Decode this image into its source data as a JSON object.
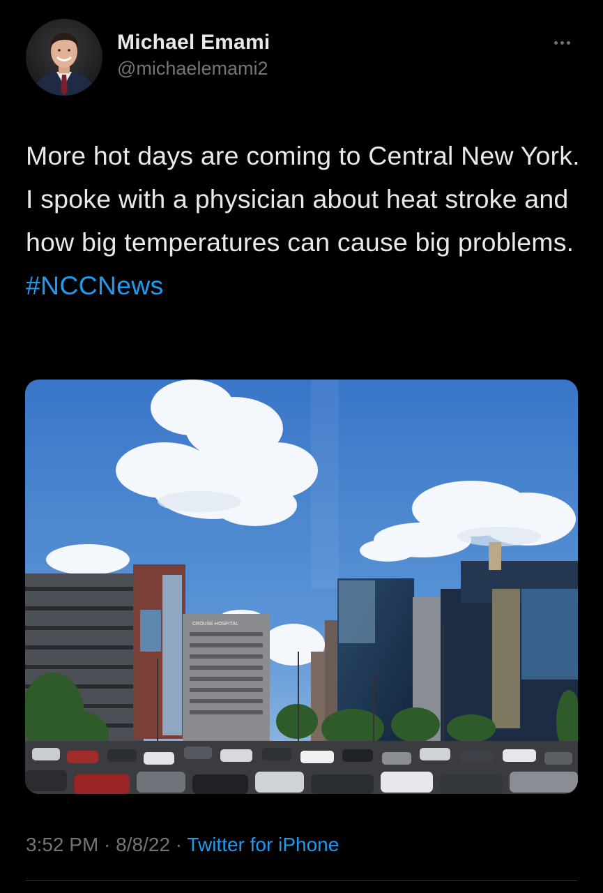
{
  "author": {
    "display_name": "Michael Emami",
    "handle": "@michaelemami2",
    "avatar_icon": "profile-photo"
  },
  "more_icon": "ellipsis-icon",
  "tweet": {
    "text": "More hot days are coming to Central New York. I spoke with a physician about heat stroke and how big temperatures can cause big problems.",
    "hashtag": "#NCCNews"
  },
  "media": {
    "sign_text": "CROUSE HOSPITAL"
  },
  "meta": {
    "time": "3:52 PM",
    "sep1": " · ",
    "date": "8/8/22",
    "sep2": " · ",
    "source": "Twitter for iPhone"
  },
  "colors": {
    "background": "#000000",
    "text": "#e7e9ea",
    "secondary": "#71767b",
    "accent": "#1d9bf0"
  }
}
